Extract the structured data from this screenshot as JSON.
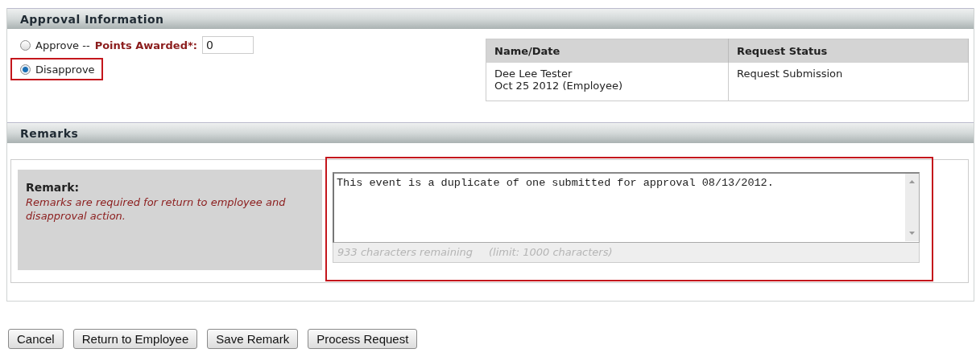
{
  "approval": {
    "title": "Approval Information",
    "options": [
      {
        "label": "Approve --",
        "selected": false,
        "highlighted": false,
        "points_label": "Points Awarded*:",
        "points_value": "0"
      },
      {
        "label": "Disapprove",
        "selected": true,
        "highlighted": true
      }
    ],
    "history": {
      "columns": [
        "Name/Date",
        "Request Status"
      ],
      "rows": [
        {
          "name": "Dee Lee Tester",
          "date": "Oct 25 2012 (Employee)",
          "status": "Request Submission"
        }
      ]
    }
  },
  "remarks": {
    "title": "Remarks",
    "label": "Remark:",
    "hint": "Remarks are required for return to employee and disapproval action.",
    "value": "This event is a duplicate of one submitted for approval 08/13/2012.",
    "highlighted": true,
    "remaining": "933 characters remaining",
    "limit": "(limit: 1000 characters)"
  },
  "buttons": [
    "Cancel",
    "Return to Employee",
    "Save Remark",
    "Process Request"
  ]
}
